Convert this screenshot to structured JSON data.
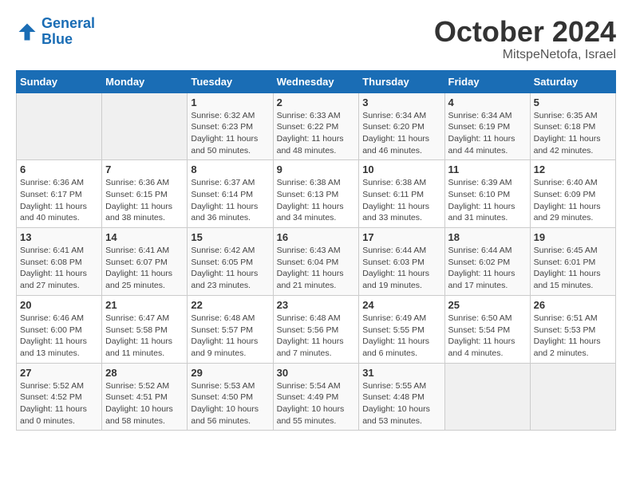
{
  "header": {
    "logo_line1": "General",
    "logo_line2": "Blue",
    "month": "October 2024",
    "location": "MitspeNetofa, Israel"
  },
  "weekdays": [
    "Sunday",
    "Monday",
    "Tuesday",
    "Wednesday",
    "Thursday",
    "Friday",
    "Saturday"
  ],
  "weeks": [
    [
      {
        "day": "",
        "info": ""
      },
      {
        "day": "",
        "info": ""
      },
      {
        "day": "1",
        "info": "Sunrise: 6:32 AM\nSunset: 6:23 PM\nDaylight: 11 hours and 50 minutes."
      },
      {
        "day": "2",
        "info": "Sunrise: 6:33 AM\nSunset: 6:22 PM\nDaylight: 11 hours and 48 minutes."
      },
      {
        "day": "3",
        "info": "Sunrise: 6:34 AM\nSunset: 6:20 PM\nDaylight: 11 hours and 46 minutes."
      },
      {
        "day": "4",
        "info": "Sunrise: 6:34 AM\nSunset: 6:19 PM\nDaylight: 11 hours and 44 minutes."
      },
      {
        "day": "5",
        "info": "Sunrise: 6:35 AM\nSunset: 6:18 PM\nDaylight: 11 hours and 42 minutes."
      }
    ],
    [
      {
        "day": "6",
        "info": "Sunrise: 6:36 AM\nSunset: 6:17 PM\nDaylight: 11 hours and 40 minutes."
      },
      {
        "day": "7",
        "info": "Sunrise: 6:36 AM\nSunset: 6:15 PM\nDaylight: 11 hours and 38 minutes."
      },
      {
        "day": "8",
        "info": "Sunrise: 6:37 AM\nSunset: 6:14 PM\nDaylight: 11 hours and 36 minutes."
      },
      {
        "day": "9",
        "info": "Sunrise: 6:38 AM\nSunset: 6:13 PM\nDaylight: 11 hours and 34 minutes."
      },
      {
        "day": "10",
        "info": "Sunrise: 6:38 AM\nSunset: 6:11 PM\nDaylight: 11 hours and 33 minutes."
      },
      {
        "day": "11",
        "info": "Sunrise: 6:39 AM\nSunset: 6:10 PM\nDaylight: 11 hours and 31 minutes."
      },
      {
        "day": "12",
        "info": "Sunrise: 6:40 AM\nSunset: 6:09 PM\nDaylight: 11 hours and 29 minutes."
      }
    ],
    [
      {
        "day": "13",
        "info": "Sunrise: 6:41 AM\nSunset: 6:08 PM\nDaylight: 11 hours and 27 minutes."
      },
      {
        "day": "14",
        "info": "Sunrise: 6:41 AM\nSunset: 6:07 PM\nDaylight: 11 hours and 25 minutes."
      },
      {
        "day": "15",
        "info": "Sunrise: 6:42 AM\nSunset: 6:05 PM\nDaylight: 11 hours and 23 minutes."
      },
      {
        "day": "16",
        "info": "Sunrise: 6:43 AM\nSunset: 6:04 PM\nDaylight: 11 hours and 21 minutes."
      },
      {
        "day": "17",
        "info": "Sunrise: 6:44 AM\nSunset: 6:03 PM\nDaylight: 11 hours and 19 minutes."
      },
      {
        "day": "18",
        "info": "Sunrise: 6:44 AM\nSunset: 6:02 PM\nDaylight: 11 hours and 17 minutes."
      },
      {
        "day": "19",
        "info": "Sunrise: 6:45 AM\nSunset: 6:01 PM\nDaylight: 11 hours and 15 minutes."
      }
    ],
    [
      {
        "day": "20",
        "info": "Sunrise: 6:46 AM\nSunset: 6:00 PM\nDaylight: 11 hours and 13 minutes."
      },
      {
        "day": "21",
        "info": "Sunrise: 6:47 AM\nSunset: 5:58 PM\nDaylight: 11 hours and 11 minutes."
      },
      {
        "day": "22",
        "info": "Sunrise: 6:48 AM\nSunset: 5:57 PM\nDaylight: 11 hours and 9 minutes."
      },
      {
        "day": "23",
        "info": "Sunrise: 6:48 AM\nSunset: 5:56 PM\nDaylight: 11 hours and 7 minutes."
      },
      {
        "day": "24",
        "info": "Sunrise: 6:49 AM\nSunset: 5:55 PM\nDaylight: 11 hours and 6 minutes."
      },
      {
        "day": "25",
        "info": "Sunrise: 6:50 AM\nSunset: 5:54 PM\nDaylight: 11 hours and 4 minutes."
      },
      {
        "day": "26",
        "info": "Sunrise: 6:51 AM\nSunset: 5:53 PM\nDaylight: 11 hours and 2 minutes."
      }
    ],
    [
      {
        "day": "27",
        "info": "Sunrise: 5:52 AM\nSunset: 4:52 PM\nDaylight: 11 hours and 0 minutes."
      },
      {
        "day": "28",
        "info": "Sunrise: 5:52 AM\nSunset: 4:51 PM\nDaylight: 10 hours and 58 minutes."
      },
      {
        "day": "29",
        "info": "Sunrise: 5:53 AM\nSunset: 4:50 PM\nDaylight: 10 hours and 56 minutes."
      },
      {
        "day": "30",
        "info": "Sunrise: 5:54 AM\nSunset: 4:49 PM\nDaylight: 10 hours and 55 minutes."
      },
      {
        "day": "31",
        "info": "Sunrise: 5:55 AM\nSunset: 4:48 PM\nDaylight: 10 hours and 53 minutes."
      },
      {
        "day": "",
        "info": ""
      },
      {
        "day": "",
        "info": ""
      }
    ]
  ]
}
